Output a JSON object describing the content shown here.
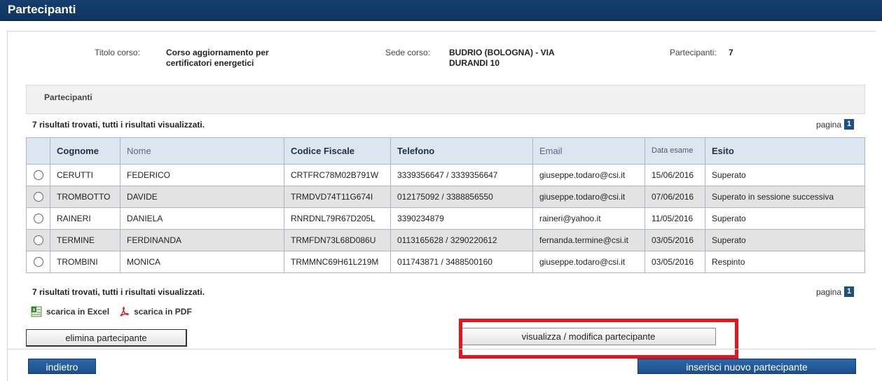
{
  "page": {
    "title": "Partecipanti"
  },
  "course": {
    "title_label": "Titolo corso:",
    "title_value": "Corso aggiornamento per certificatori energetici",
    "site_label": "Sede corso:",
    "site_value": "BUDRIO (BOLOGNA) - VIA DURANDI 10",
    "participants_label": "Partecipanti:",
    "participants_value": "7"
  },
  "section": {
    "title": "Partecipanti"
  },
  "results_text": "7 risultati trovati, tutti i risultati visualizzati.",
  "pager": {
    "label": "pagina",
    "current": "1"
  },
  "table": {
    "headers": {
      "cognome": "Cognome",
      "nome": "Nome",
      "codice_fiscale": "Codice Fiscale",
      "telefono": "Telefono",
      "email": "Email",
      "data_esame": "Data esame",
      "esito": "Esito"
    },
    "rows": [
      {
        "cognome": "CERUTTI",
        "nome": "FEDERICO",
        "codice_fiscale": "CRTFRC78M02B791W",
        "telefono": "3339356647 / 3339356647",
        "email": "giuseppe.todaro@csi.it",
        "data_esame": "15/06/2016",
        "esito": "Superato"
      },
      {
        "cognome": "TROMBOTTO",
        "nome": "DAVIDE",
        "codice_fiscale": "TRMDVD74T11G674I",
        "telefono": "012175092 / 3388856550",
        "email": "giuseppe.todaro@csi.it",
        "data_esame": "07/06/2016",
        "esito": "Superato in sessione successiva"
      },
      {
        "cognome": "RAINERI",
        "nome": "DANIELA",
        "codice_fiscale": "RNRDNL79R67D205L",
        "telefono": "3390234879",
        "email": "raineri@yahoo.it",
        "data_esame": "11/05/2016",
        "esito": "Superato"
      },
      {
        "cognome": "TERMINE",
        "nome": "FERDINANDA",
        "codice_fiscale": "TRMFDN73L68D086U",
        "telefono": "0113165628 / 3290220612",
        "email": "fernanda.termine@csi.it",
        "data_esame": "03/05/2016",
        "esito": "Superato"
      },
      {
        "cognome": "TROMBINI",
        "nome": "MONICA",
        "codice_fiscale": "TRMMNC69H61L219M",
        "telefono": "011743871 / 3488500160",
        "email": "giuseppe.todaro@csi.it",
        "data_esame": "03/05/2016",
        "esito": "Respinto"
      }
    ]
  },
  "downloads": {
    "excel": "scarica in Excel",
    "pdf": "scarica in PDF"
  },
  "buttons": {
    "delete": "elimina partecipante",
    "view_edit": "visualizza / modifica partecipante",
    "back": "indietro",
    "new": "inserisci nuovo partecipante"
  },
  "colors": {
    "header_bg": "#0f3563",
    "highlight": "#e8131b",
    "table_header": "#dce6f1",
    "button_blue": "#1c4f8d"
  }
}
